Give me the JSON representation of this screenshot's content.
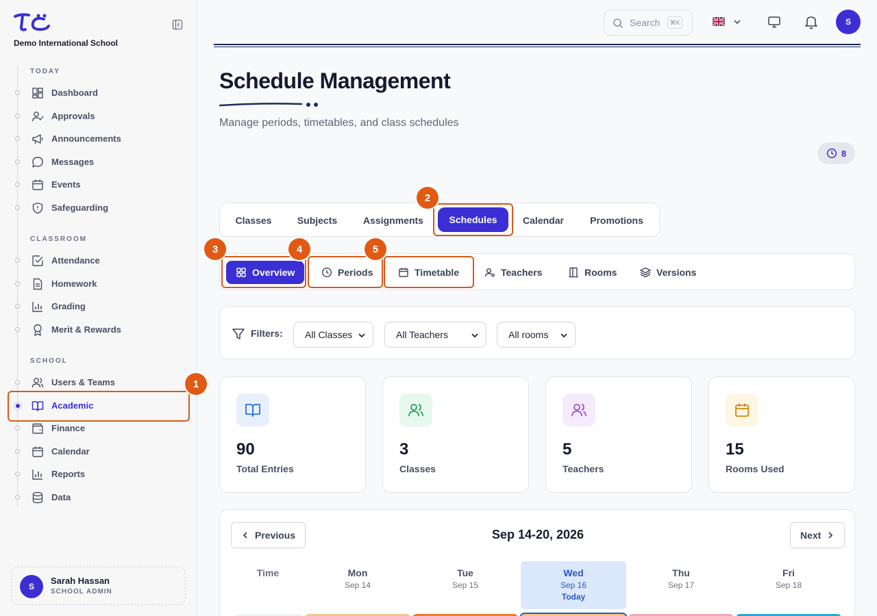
{
  "sidebar": {
    "school_name": "Demo International School",
    "sections": {
      "today": "TODAY",
      "classroom": "CLASSROOM",
      "school": "SCHOOL"
    },
    "items": [
      {
        "label": "Dashboard",
        "icon": "dashboard-icon"
      },
      {
        "label": "Approvals",
        "icon": "user-check-icon"
      },
      {
        "label": "Announcements",
        "icon": "megaphone-icon"
      },
      {
        "label": "Messages",
        "icon": "message-icon"
      },
      {
        "label": "Events",
        "icon": "calendar-icon"
      },
      {
        "label": "Safeguarding",
        "icon": "shield-icon"
      },
      {
        "label": "Attendance",
        "icon": "check-square-icon"
      },
      {
        "label": "Homework",
        "icon": "file-icon"
      },
      {
        "label": "Grading",
        "icon": "bar-chart-icon"
      },
      {
        "label": "Merit & Rewards",
        "icon": "award-icon"
      },
      {
        "label": "Users & Teams",
        "icon": "users-icon"
      },
      {
        "label": "Academic",
        "icon": "book-icon",
        "active": true
      },
      {
        "label": "Finance",
        "icon": "wallet-icon"
      },
      {
        "label": "Calendar",
        "icon": "calendar-icon"
      },
      {
        "label": "Reports",
        "icon": "bar-chart-icon"
      },
      {
        "label": "Data",
        "icon": "database-icon"
      }
    ],
    "user": {
      "initial": "S",
      "name": "Sarah Hassan",
      "role": "SCHOOL ADMIN"
    }
  },
  "topbar": {
    "search_placeholder": "Search",
    "search_shortcut": "⌘K",
    "avatar_initial": "S"
  },
  "page": {
    "title": "Schedule Management",
    "subtitle": "Manage periods, timetables, and class schedules",
    "count_badge": "8"
  },
  "main_tabs": [
    "Classes",
    "Subjects",
    "Assignments",
    "Schedules",
    "Calendar",
    "Promotions"
  ],
  "active_main_tab": "Schedules",
  "sub_tabs": [
    "Overview",
    "Periods",
    "Timetable",
    "Teachers",
    "Rooms",
    "Versions"
  ],
  "active_sub_tab": "Overview",
  "step_badges": [
    "1",
    "2",
    "3",
    "4",
    "5"
  ],
  "filters": {
    "label": "Filters:",
    "classes": "All Classes",
    "teachers": "All Teachers",
    "rooms": "All rooms"
  },
  "stats": [
    {
      "value": "90",
      "label": "Total Entries"
    },
    {
      "value": "3",
      "label": "Classes"
    },
    {
      "value": "5",
      "label": "Teachers"
    },
    {
      "value": "15",
      "label": "Rooms Used"
    }
  ],
  "calendar": {
    "prev": "Previous",
    "next": "Next",
    "range": "Sep 14-20, 2026",
    "time_header": "Time",
    "days": [
      {
        "name": "Mon",
        "date": "Sep 14"
      },
      {
        "name": "Tue",
        "date": "Sep 15"
      },
      {
        "name": "Wed",
        "date": "Sep 16",
        "today": "Today"
      },
      {
        "name": "Thu",
        "date": "Sep 17"
      },
      {
        "name": "Fri",
        "date": "Sep 18"
      }
    ]
  },
  "colors": {
    "accent": "#3b2fd4",
    "highlight": "#d8591a",
    "badge": "#e05a14"
  }
}
